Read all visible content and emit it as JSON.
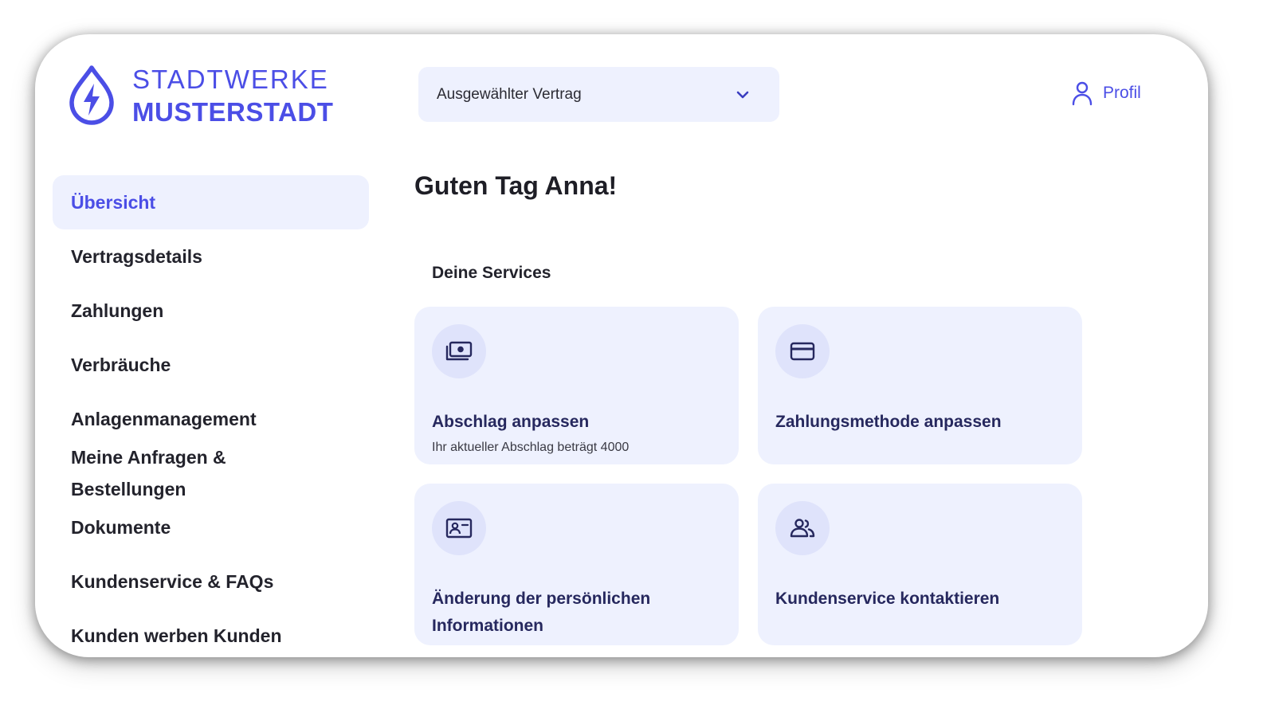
{
  "brand": {
    "line1": "STADTWERKE",
    "line2": "MUSTERSTADT",
    "accent_color": "#4b4ee6",
    "logo_icon": "water-drop-lightning-icon"
  },
  "header": {
    "contract_select": {
      "value": "Ausgewählter Vertrag",
      "icon": "chevron-down-icon"
    },
    "profile": {
      "label": "Profil",
      "icon": "user-icon"
    }
  },
  "sidebar": {
    "items": [
      {
        "label": "Übersicht",
        "active": true
      },
      {
        "label": "Vertragsdetails"
      },
      {
        "label": "Zahlungen"
      },
      {
        "label": "Verbräuche"
      },
      {
        "label": "Anlagenmanagement"
      },
      {
        "label": "Meine Anfragen & Bestellungen"
      },
      {
        "label": "Dokumente"
      },
      {
        "label": "Kundenservice & FAQs"
      },
      {
        "label": "Kunden werben Kunden"
      }
    ]
  },
  "main": {
    "greeting": "Guten Tag Anna!",
    "services_title": "Deine Services",
    "cards": [
      {
        "title": "Abschlag anpassen",
        "subtitle": "Ihr aktueller Abschlag beträgt 4000",
        "icon": "money-bill-icon"
      },
      {
        "title": "Zahlungsmethode anpassen",
        "icon": "credit-card-icon"
      },
      {
        "title": "Änderung der persönlichen Informationen",
        "icon": "id-card-icon"
      },
      {
        "title": "Kundenservice kontaktieren",
        "icon": "users-icon"
      }
    ]
  },
  "colors": {
    "card_background": "#eef1fe",
    "icon_circle": "#dfe3fb",
    "card_title": "#26285e"
  }
}
